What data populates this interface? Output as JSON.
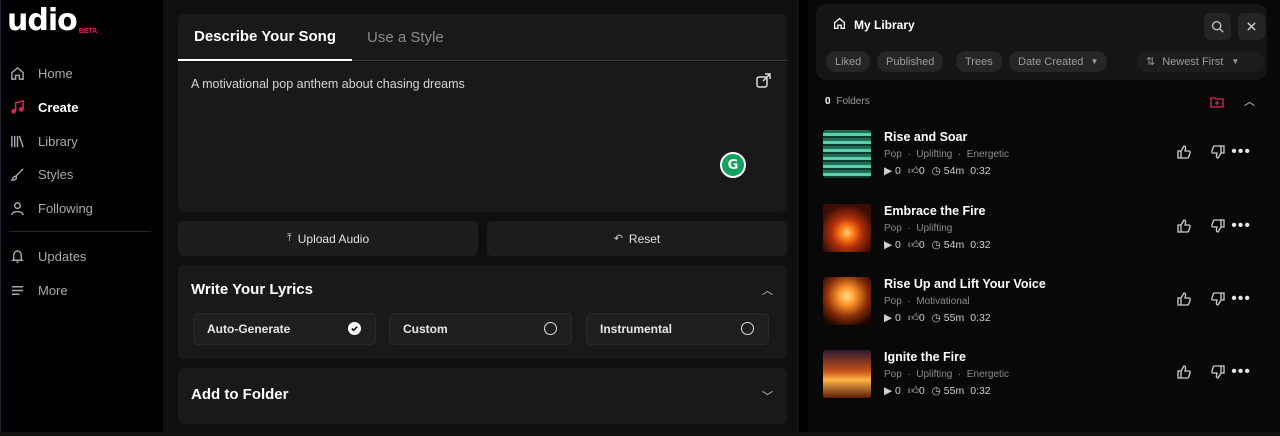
{
  "logo": {
    "word": "udio",
    "badge": "BETA"
  },
  "nav": [
    {
      "label": "Home",
      "icon": "home-icon"
    },
    {
      "label": "Create",
      "icon": "music-note-icon",
      "active": true
    },
    {
      "label": "Library",
      "icon": "library-icon"
    },
    {
      "label": "Styles",
      "icon": "brush-icon"
    },
    {
      "label": "Following",
      "icon": "user-icon"
    },
    {
      "label": "Updates",
      "icon": "bell-icon"
    },
    {
      "label": "More",
      "icon": "menu-icon"
    }
  ],
  "tabs": {
    "describe": "Describe Your Song",
    "style": "Use a Style"
  },
  "prompt": {
    "text": "A motivational pop anthem about chasing dreams",
    "grammarly_letter": "G"
  },
  "buttons": {
    "upload": "Upload Audio",
    "reset": "Reset"
  },
  "lyrics": {
    "title": "Write Your Lyrics",
    "options": [
      {
        "label": "Auto-Generate",
        "selected": true
      },
      {
        "label": "Custom",
        "selected": false
      },
      {
        "label": "Instrumental",
        "selected": false
      }
    ]
  },
  "folder": {
    "title": "Add to Folder"
  },
  "library": {
    "title": "My Library",
    "filters": [
      "Liked",
      "Published",
      "Trees",
      "Date Created"
    ],
    "sort": "Newest First",
    "folders_count": "0",
    "folders_label": "Folders",
    "songs": [
      {
        "title": "Rise and Soar",
        "tags": "Pop  ·  Uplifting  ·  Energetic",
        "plays": "0",
        "likes": "0",
        "age": "54m",
        "duration": "0:32"
      },
      {
        "title": "Embrace the Fire",
        "tags": "Pop  ·  Uplifting",
        "plays": "0",
        "likes": "0",
        "age": "54m",
        "duration": "0:32"
      },
      {
        "title": "Rise Up and Lift Your Voice",
        "tags": "Pop  ·  Motivational",
        "plays": "0",
        "likes": "0",
        "age": "55m",
        "duration": "0:32"
      },
      {
        "title": "Ignite the Fire",
        "tags": "Pop  ·  Uplifting  ·  Energetic",
        "plays": "0",
        "likes": "0",
        "age": "55m",
        "duration": "0:32"
      }
    ]
  },
  "colors": {
    "accent": "#e0245e",
    "background": "#000000",
    "panel": "#191919"
  }
}
